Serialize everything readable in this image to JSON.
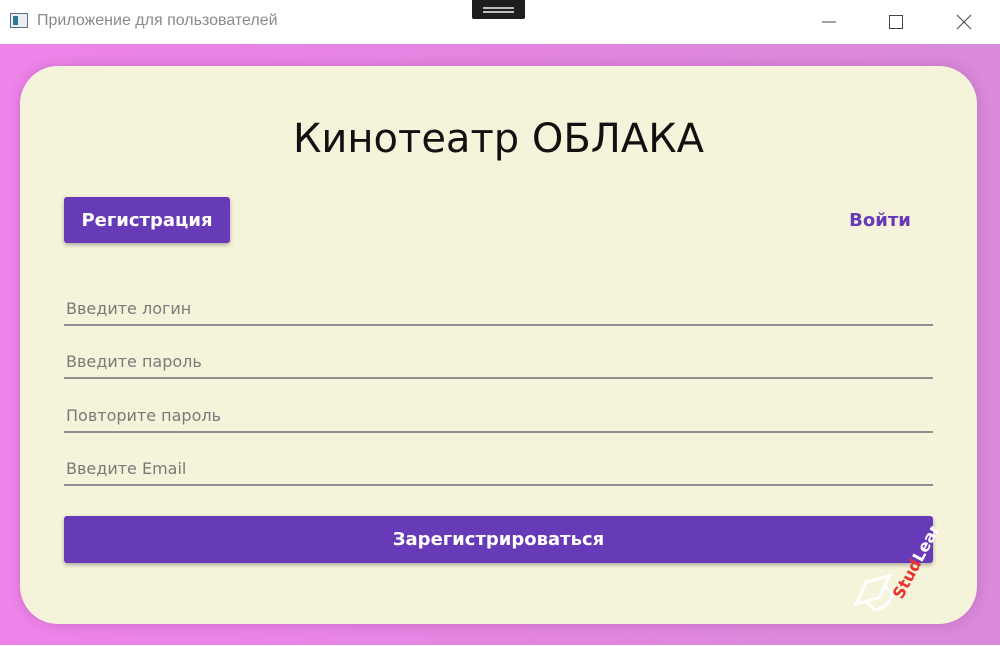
{
  "window": {
    "title": "Приложение для пользователей"
  },
  "page": {
    "heading": "Кинотеатр ОБЛАКА",
    "tabs": {
      "register_label": "Регистрация",
      "login_label": "Войти"
    },
    "form": {
      "login_placeholder": "Введите логин",
      "password_placeholder": "Введите пароль",
      "repeat_password_placeholder": "Повторите пароль",
      "email_placeholder": "Введите Email",
      "login_value": "",
      "password_value": "",
      "repeat_password_value": "",
      "email_value": ""
    },
    "submit_label": "Зарегистрироваться"
  },
  "watermark": {
    "text_a": "Stud",
    "text_b": "Learn"
  },
  "colors": {
    "accent": "#673ab7",
    "card": "#f5f3da",
    "background": "#e485e1",
    "watermark_red": "#e8322c"
  },
  "icons": [
    "app-window-icon",
    "minimize-icon",
    "maximize-icon",
    "close-icon",
    "graduation-cap-icon"
  ]
}
